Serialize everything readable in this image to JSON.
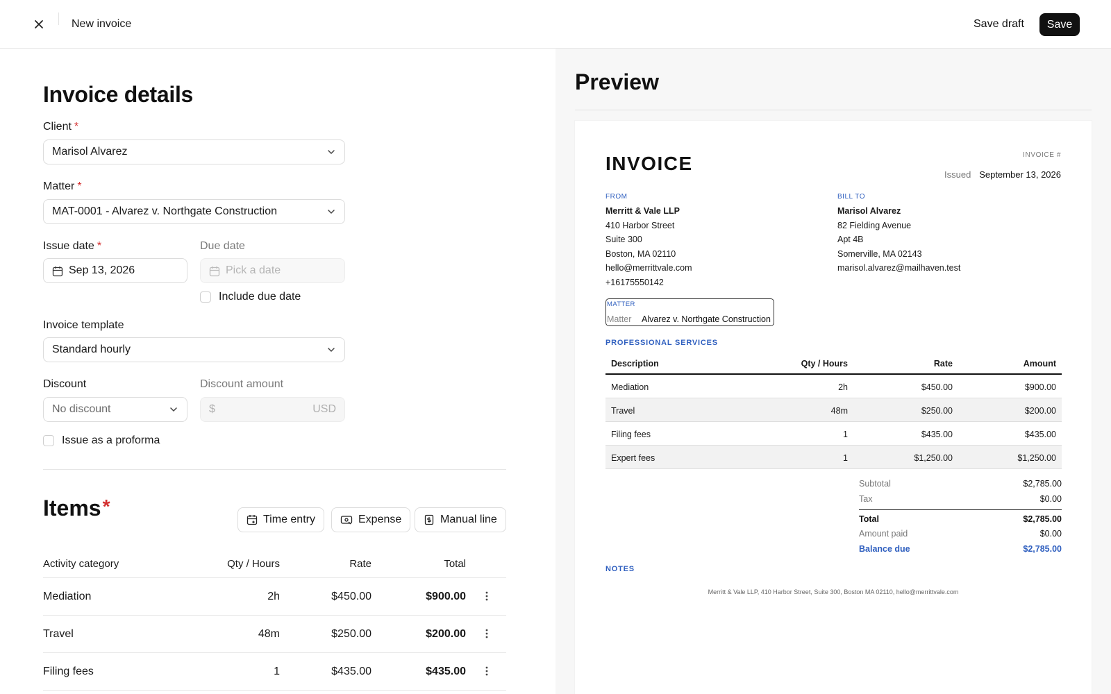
{
  "topbar": {
    "title": "New invoice",
    "save_draft_label": "Save draft",
    "save_label": "Save"
  },
  "form": {
    "heading": "Invoice details",
    "client": {
      "label": "Client",
      "value": "Marisol Alvarez"
    },
    "matter": {
      "label": "Matter",
      "value": "MAT-0001 - Alvarez v. Northgate Construction"
    },
    "issue_date": {
      "label": "Issue date",
      "value": "Sep 13, 2026"
    },
    "due_date": {
      "label": "Due date",
      "placeholder": "Pick a date"
    },
    "include_due_date_label": "Include due date",
    "template": {
      "label": "Invoice template",
      "value": "Standard hourly"
    },
    "discount": {
      "label": "Discount",
      "value": "No discount"
    },
    "discount_amount": {
      "label": "Discount amount",
      "prefix": "$",
      "suffix": "USD"
    },
    "proforma_label": "Issue as a proforma",
    "required_marker": "*"
  },
  "items": {
    "heading": "Items",
    "buttons": {
      "time_entry": "Time entry",
      "expense": "Expense",
      "manual_line": "Manual line"
    },
    "columns": {
      "category": "Activity category",
      "qty": "Qty / Hours",
      "rate": "Rate",
      "total": "Total"
    },
    "rows": [
      {
        "category": "Mediation",
        "qty": "2h",
        "rate": "$450.00",
        "total": "$900.00"
      },
      {
        "category": "Travel",
        "qty": "48m",
        "rate": "$250.00",
        "total": "$200.00"
      },
      {
        "category": "Filing fees",
        "qty": "1",
        "rate": "$435.00",
        "total": "$435.00"
      }
    ]
  },
  "preview": {
    "heading": "Preview",
    "invoice_title": "INVOICE",
    "invoice_number_label": "INVOICE #",
    "issued_label": "Issued",
    "issued_value": "September 13, 2026",
    "from_label": "FROM",
    "from": {
      "name": "Merritt & Vale LLP",
      "line1": "410 Harbor Street",
      "line2": "Suite 300",
      "line3": "Boston, MA 02110",
      "email": "hello@merrittvale.com",
      "phone": "+16175550142"
    },
    "bill_to_label": "BILL TO",
    "bill_to": {
      "name": "Marisol Alvarez",
      "line1": "82 Fielding Avenue",
      "line2": "Apt 4B",
      "line3": "Somerville, MA 02143",
      "email": "marisol.alvarez@mailhaven.test"
    },
    "matter_label": "MATTER",
    "matter_key": "Matter",
    "matter_value": "Alvarez v. Northgate Construction",
    "services_label": "PROFESSIONAL SERVICES",
    "columns": {
      "description": "Description",
      "qty": "Qty / Hours",
      "rate": "Rate",
      "amount": "Amount"
    },
    "rows": [
      {
        "description": "Mediation",
        "qty": "2h",
        "rate": "$450.00",
        "amount": "$900.00"
      },
      {
        "description": "Travel",
        "qty": "48m",
        "rate": "$250.00",
        "amount": "$200.00"
      },
      {
        "description": "Filing fees",
        "qty": "1",
        "rate": "$435.00",
        "amount": "$435.00"
      },
      {
        "description": "Expert fees",
        "qty": "1",
        "rate": "$1,250.00",
        "amount": "$1,250.00"
      }
    ],
    "totals": {
      "subtotal_label": "Subtotal",
      "subtotal": "$2,785.00",
      "tax_label": "Tax",
      "tax": "$0.00",
      "total_label": "Total",
      "total": "$2,785.00",
      "paid_label": "Amount paid",
      "paid": "$0.00",
      "balance_label": "Balance due",
      "balance": "$2,785.00"
    },
    "notes_label": "NOTES",
    "footer": "Merritt & Vale LLP, 410 Harbor Street, Suite 300, Boston MA 02110, hello@merrittvale.com"
  },
  "colors": {
    "accent_blue": "#2f5fbf",
    "required_red": "#d32f2f",
    "primary_dark": "#111111"
  }
}
